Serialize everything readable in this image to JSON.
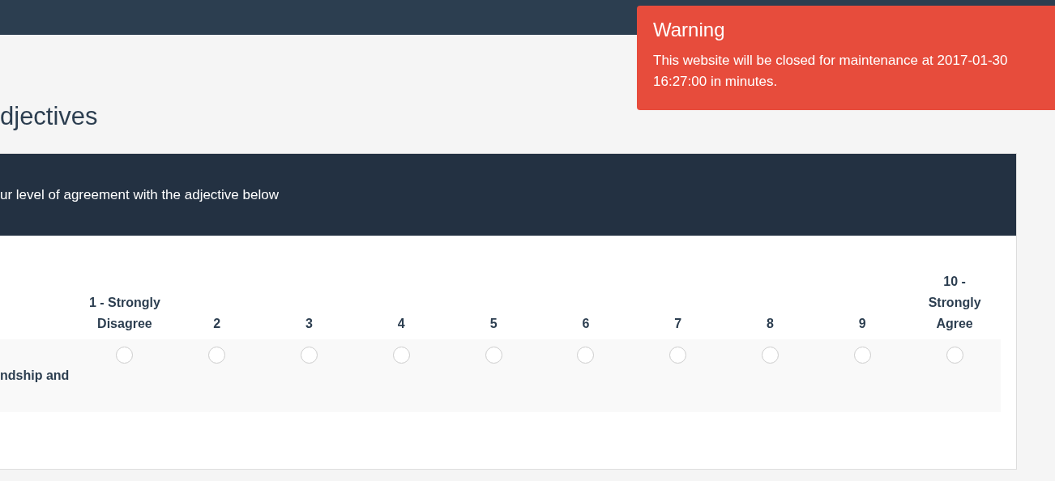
{
  "toast": {
    "title": "Warning",
    "message": "This website will be closed for maintenance at 2017-01-30 16:27:00 in minutes."
  },
  "group_title": "djectives",
  "question": {
    "text": "ur level of agreement with the adjective below",
    "columns": [
      "1 - Strongly Disagree",
      "2",
      "3",
      "4",
      "5",
      "6",
      "7",
      "8",
      "9",
      "10 - Strongly Agree"
    ],
    "rows": [
      {
        "label": "ndship and",
        "options": [
          {
            "selected": false
          },
          {
            "selected": false
          },
          {
            "selected": false
          },
          {
            "selected": false
          },
          {
            "selected": false
          },
          {
            "selected": false
          },
          {
            "selected": false
          },
          {
            "selected": false
          },
          {
            "selected": false
          },
          {
            "selected": false
          }
        ]
      }
    ]
  }
}
